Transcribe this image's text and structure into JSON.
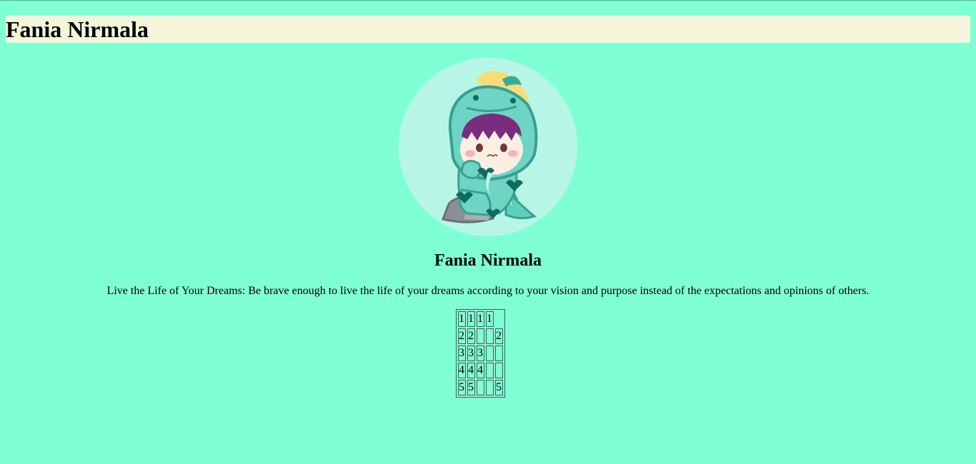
{
  "header": {
    "title": "Fania Nirmala",
    "background": "#f5f5dc"
  },
  "page_background": "#7fffd4",
  "profile": {
    "avatar_icon": "chibi-dinosaur-costume-avatar",
    "name": "Fania Nirmala",
    "quote": "Live the Life of Your Dreams: Be brave enough to live the life of your dreams according to your vision and purpose instead of the expectations and opinions of others."
  },
  "table": {
    "rows": [
      [
        "1",
        "1",
        "1",
        "1",
        null
      ],
      [
        "2",
        "2",
        "",
        "",
        "2"
      ],
      [
        "3",
        "3",
        "3",
        "",
        ""
      ],
      [
        "4",
        "4",
        "4",
        "",
        ""
      ],
      [
        "5",
        "5",
        "",
        "",
        "5"
      ]
    ]
  }
}
